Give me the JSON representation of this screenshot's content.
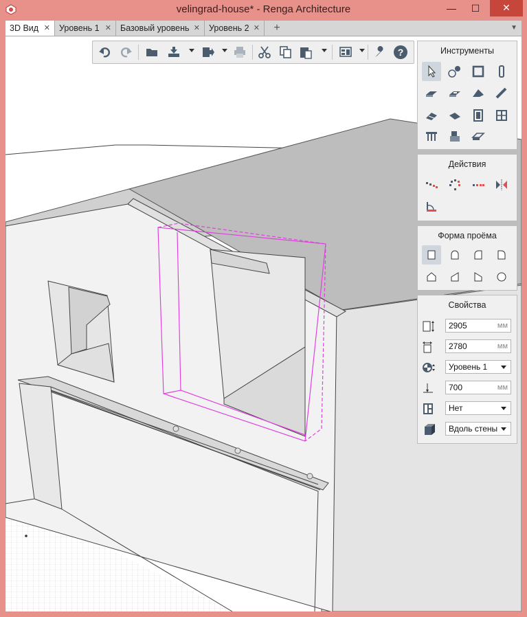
{
  "window": {
    "title": "velingrad-house* - Renga Architecture",
    "minimize": "—",
    "maximize": "☐",
    "close": "✕"
  },
  "tabs": [
    {
      "label": "3D Вид",
      "close": "✕"
    },
    {
      "label": "Уровень 1",
      "close": "✕"
    },
    {
      "label": "Базовый уровень",
      "close": "✕"
    },
    {
      "label": "Уровень 2",
      "close": "✕"
    }
  ],
  "tab_add": "+",
  "tab_menu": "▼",
  "toolbar": {
    "icons": [
      "undo-icon",
      "redo-icon",
      "open-folder-icon",
      "import-icon",
      "export-icon",
      "print-icon",
      "cut-icon",
      "copy-icon",
      "paste-icon",
      "view-layout-icon",
      "settings-wrench-icon",
      "help-icon"
    ],
    "help_label": "?"
  },
  "panels": {
    "tools": {
      "title": "Инструменты"
    },
    "actions": {
      "title": "Действия"
    },
    "opening_shape": {
      "title": "Форма проёма"
    },
    "properties": {
      "title": "Свойства",
      "height": {
        "value": "2905",
        "unit": "мм"
      },
      "width": {
        "value": "2780",
        "unit": "мм"
      },
      "level": {
        "value": "Уровень 1"
      },
      "offset": {
        "value": "700",
        "unit": "мм"
      },
      "fill": {
        "value": "Нет"
      },
      "placement": {
        "value": "Вдоль стены"
      }
    }
  },
  "colors": {
    "accent": "#e05050",
    "selection": "#e040e0",
    "panel_bg": "#f0f0f0",
    "title_bg": "#e8908a"
  }
}
